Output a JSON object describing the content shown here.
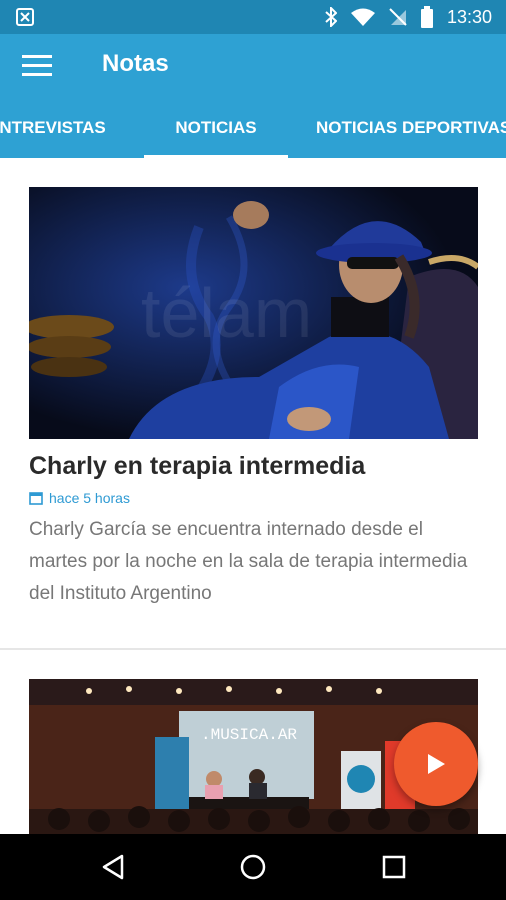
{
  "status_bar": {
    "time": "13:30",
    "icons": [
      "notification-icon",
      "bluetooth-icon",
      "wifi-icon",
      "no-sim-icon",
      "battery-icon"
    ]
  },
  "app_bar": {
    "title": "Notas",
    "menu_icon": "hamburger-menu-icon"
  },
  "tabs": [
    {
      "label": "ENTREVISTAS",
      "active": false
    },
    {
      "label": "NOTICIAS",
      "active": true
    },
    {
      "label": "NOTICIAS DEPORTIVAS",
      "active": false
    }
  ],
  "articles": [
    {
      "headline": "Charly en terapia intermedia",
      "time_ago": "hace 5 horas",
      "summary": "Charly García se encuentra internado desde el martes por la noche en la sala de terapia intermedia del Instituto Argentino",
      "image_watermark": "télam"
    },
    {
      "image_text": ".MUSICA.AR"
    }
  ],
  "fab": {
    "icon": "play-icon"
  },
  "colors": {
    "status_bar": "#1f86b3",
    "app_bar": "#2ea1d3",
    "accent": "#2e9ad3",
    "fab": "#ef5a2d"
  },
  "nav_bar": {
    "icons": [
      "back-icon",
      "home-icon",
      "recents-icon"
    ]
  }
}
